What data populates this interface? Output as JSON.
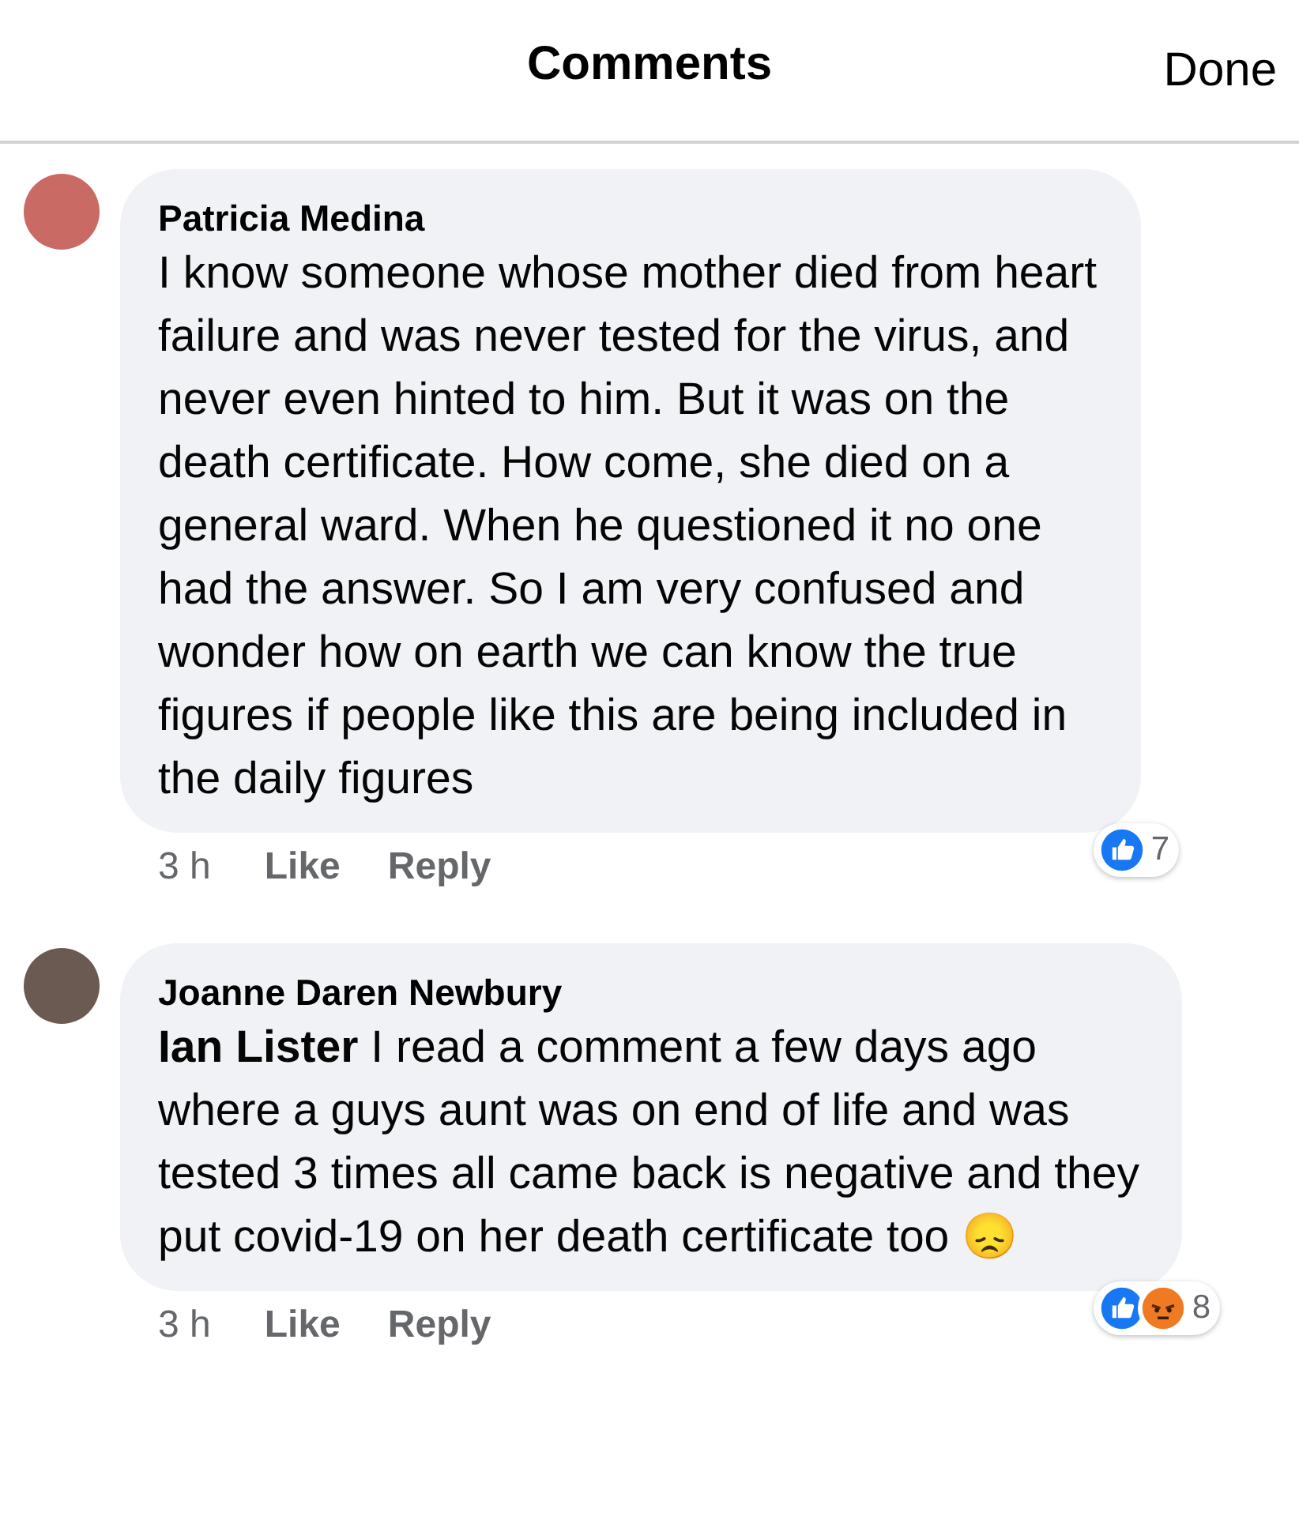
{
  "header": {
    "title": "Comments",
    "done": "Done"
  },
  "comments": [
    {
      "author": "Patricia Medina",
      "text": "I know someone whose mother died from heart failure and was never tested for the virus, and never even hinted to him. But it was on the death certificate. How come, she died on a general ward. When he questioned it no one had the answer. So I am very confused and wonder how on earth we can know the true figures if people like this are being included in the daily figures",
      "time": "3 h",
      "like": "Like",
      "reply": "Reply",
      "reactions": [
        {
          "kind": "like"
        }
      ],
      "reaction_count": "7"
    },
    {
      "author": "Joanne Daren Newbury",
      "text": "**Ian Lister** I read a comment a few days ago where a guys aunt was on end of life and was tested 3 times all came back is negative and they put covid-19 on her death certificate too 😞",
      "time": "3 h",
      "like": "Like",
      "reply": "Reply",
      "reactions": [
        {
          "kind": "like"
        },
        {
          "kind": "angry"
        }
      ],
      "reaction_count": "8"
    }
  ]
}
